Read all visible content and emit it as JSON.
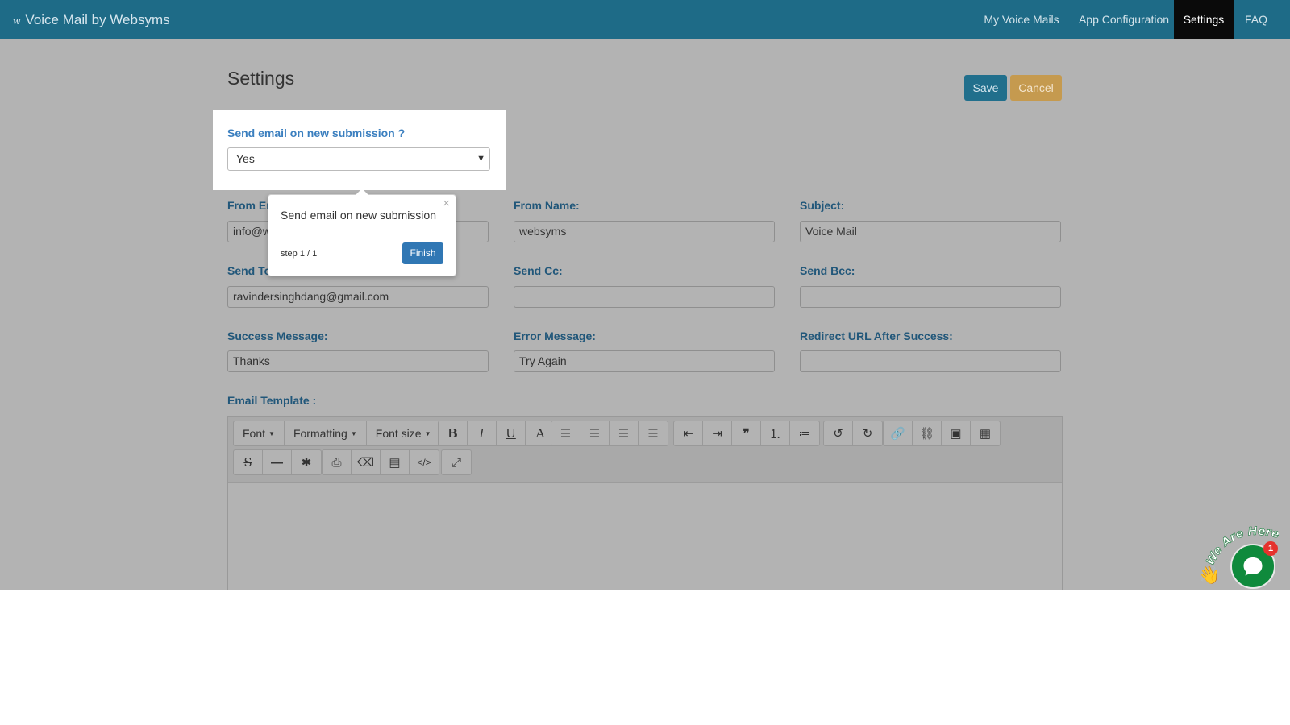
{
  "brand": {
    "logo": "w",
    "title": "Voice Mail by Websyms"
  },
  "nav": [
    {
      "label": "My Voice Mails",
      "active": false
    },
    {
      "label": "App Configuration",
      "active": false
    },
    {
      "label": "Settings",
      "active": true
    },
    {
      "label": "FAQ",
      "active": false
    }
  ],
  "page": {
    "title": "Settings"
  },
  "actions": {
    "save": "Save",
    "cancel": "Cancel"
  },
  "send_email": {
    "label": "Send email on new submission ?",
    "value": "Yes"
  },
  "fields": {
    "from_email": {
      "label": "From Email:",
      "value": "info@websyms.com"
    },
    "from_name": {
      "label": "From Name:",
      "value": "websyms"
    },
    "subject": {
      "label": "Subject:",
      "value": "Voice Mail"
    },
    "send_to": {
      "label": "Send To:",
      "value": "ravindersinghdang@gmail.com"
    },
    "send_cc": {
      "label": "Send Cc:",
      "value": ""
    },
    "send_bcc": {
      "label": "Send Bcc:",
      "value": ""
    },
    "success_message": {
      "label": "Success Message:",
      "value": "Thanks"
    },
    "error_message": {
      "label": "Error Message:",
      "value": "Try Again"
    },
    "redirect_url": {
      "label": "Redirect URL After Success:",
      "value": ""
    }
  },
  "tour": {
    "content": "Send email on new submission",
    "close": "×",
    "step": "step 1 / 1",
    "finish": "Finish"
  },
  "editor": {
    "label": "Email Template :",
    "dropdowns": {
      "font": "Font",
      "formatting": "Formatting",
      "font_size": "Font size"
    },
    "icons": [
      "bold-icon",
      "italic-icon",
      "underline-icon",
      "font-color-icon",
      "align-left-icon",
      "align-center-icon",
      "align-right-icon",
      "align-justify-icon",
      "outdent-icon",
      "indent-icon",
      "blockquote-icon",
      "ordered-list-icon",
      "unordered-list-icon",
      "undo-icon",
      "redo-icon",
      "link-icon",
      "unlink-icon",
      "image-icon",
      "table-icon",
      "strikethrough-icon",
      "horizontal-rule-icon",
      "special-char-icon",
      "print-icon",
      "eraser-icon",
      "paste-word-icon",
      "code-view-icon",
      "fullscreen-icon"
    ]
  },
  "chat": {
    "badge": "1",
    "tagline": "We Are Here!"
  }
}
